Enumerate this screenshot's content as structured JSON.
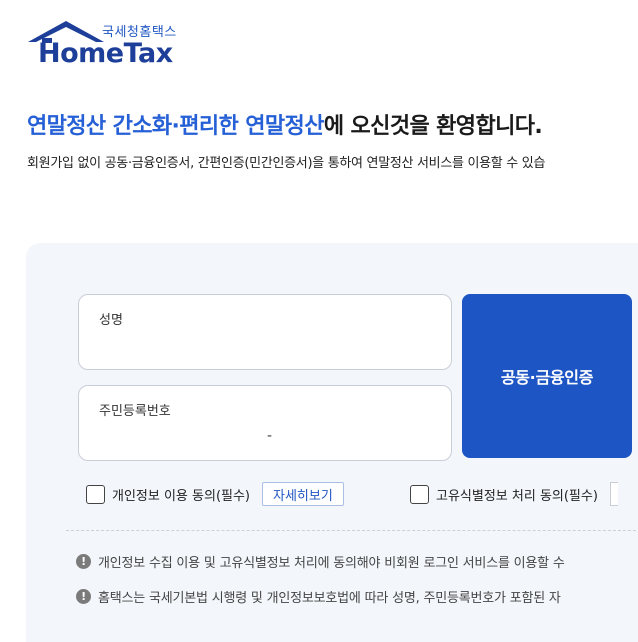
{
  "logo": {
    "sub": "국세청홈택스",
    "main": "HomeTax"
  },
  "welcome": {
    "highlight": "연말정산 간소화·편리한 연말정산",
    "rest": "에 오신것을 환영합니다."
  },
  "description": "회원가입 없이 공동·금융인증서, 간편인증(민간인증서)을 통하여 연말정산 서비스를 이용할 수 있습",
  "form": {
    "name_label": "성명",
    "rrn_label": "주민등록번호",
    "rrn_separator": "-",
    "auth_button": "공동·금융인증"
  },
  "agreements": [
    {
      "label": "개인정보 이용 동의(필수)",
      "detail": "자세히보기"
    },
    {
      "label": "고유식별정보 처리 동의(필수)"
    }
  ],
  "notes": [
    {
      "icon": "!",
      "text": "개인정보 수집 이용 및 고유식별정보 처리에 동의해야 비회원 로그인 서비스를 이용할 수"
    },
    {
      "icon": "!",
      "text": "홈택스는 국세기본법 시행령 및 개인정보보호법에 따라 성명, 주민등록번호가 포함된 자"
    }
  ],
  "colors": {
    "accent": "#1e55c5",
    "highlight": "#2660d6",
    "panel_bg": "#f3f7fb"
  }
}
